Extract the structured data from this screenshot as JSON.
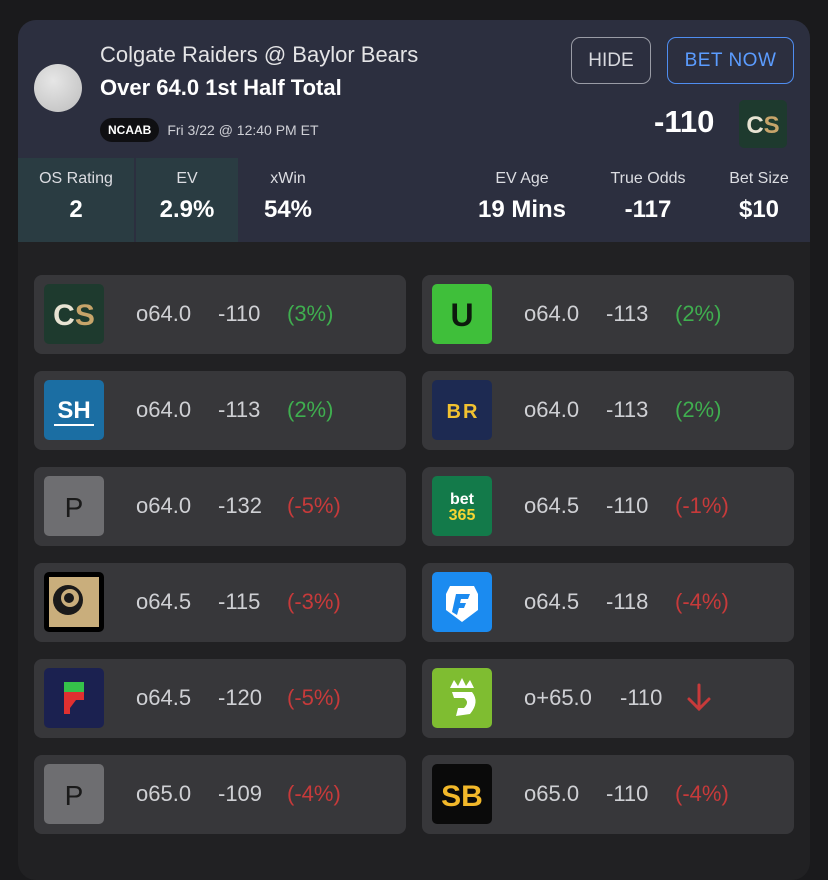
{
  "header": {
    "matchup": "Colgate Raiders @ Baylor Bears",
    "market": "Over 64.0 1st Half Total",
    "league_badge": "NCAAB",
    "game_time": "Fri 3/22 @ 12:40 PM ET",
    "hide_label": "HIDE",
    "bet_label": "BET NOW",
    "best_odds": "-110",
    "best_book_logo": "CS"
  },
  "stats": {
    "os_rating_label": "OS Rating",
    "os_rating": "2",
    "ev_label": "EV",
    "ev": "2.9%",
    "xwin_label": "xWin",
    "xwin": "54%",
    "ev_age_label": "EV Age",
    "ev_age": "19 Mins",
    "true_odds_label": "True Odds",
    "true_odds": "-117",
    "bet_size_label": "Bet Size",
    "bet_size": "$10"
  },
  "books": [
    {
      "logo": "CS",
      "line": "o64.0",
      "price": "-110",
      "ev": "(3%)",
      "ev_sign": "pos"
    },
    {
      "logo": "U",
      "line": "o64.0",
      "price": "-113",
      "ev": "(2%)",
      "ev_sign": "pos"
    },
    {
      "logo": "SH",
      "line": "o64.0",
      "price": "-113",
      "ev": "(2%)",
      "ev_sign": "pos"
    },
    {
      "logo": "BR",
      "line": "o64.0",
      "price": "-113",
      "ev": "(2%)",
      "ev_sign": "pos"
    },
    {
      "logo": "P",
      "line": "o64.0",
      "price": "-132",
      "ev": "(-5%)",
      "ev_sign": "neg"
    },
    {
      "logo": "bet365",
      "line": "o64.5",
      "price": "-110",
      "ev": "(-1%)",
      "ev_sign": "neg"
    },
    {
      "logo": "lion-icon",
      "line": "o64.5",
      "price": "-115",
      "ev": "(-3%)",
      "ev_sign": "neg"
    },
    {
      "logo": "fanduel-icon",
      "line": "o64.5",
      "price": "-118",
      "ev": "(-4%)",
      "ev_sign": "neg"
    },
    {
      "logo": "flag-icon",
      "line": "o64.5",
      "price": "-120",
      "ev": "(-5%)",
      "ev_sign": "neg"
    },
    {
      "logo": "draftkings-icon",
      "line": "o+65.0",
      "price": "-110",
      "ev": "",
      "ev_sign": "down-arrow-icon"
    },
    {
      "logo": "P",
      "line": "o65.0",
      "price": "-109",
      "ev": "(-4%)",
      "ev_sign": "neg"
    },
    {
      "logo": "SB",
      "line": "o65.0",
      "price": "-110",
      "ev": "(-4%)",
      "ev_sign": "neg"
    }
  ],
  "colors": {
    "positive": "#3fae4f",
    "negative": "#c73a3a",
    "accent": "#5b9cff"
  }
}
